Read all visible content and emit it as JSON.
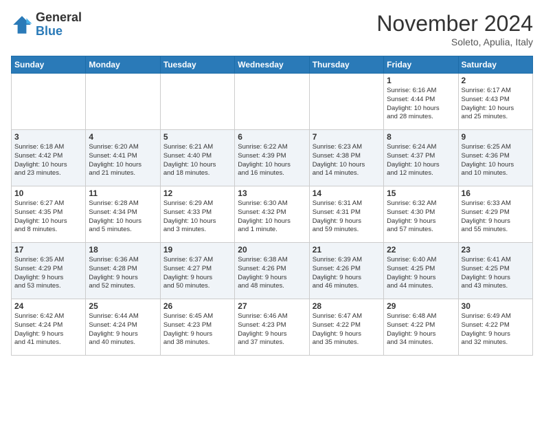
{
  "header": {
    "logo_general": "General",
    "logo_blue": "Blue",
    "month_title": "November 2024",
    "location": "Soleto, Apulia, Italy"
  },
  "days_of_week": [
    "Sunday",
    "Monday",
    "Tuesday",
    "Wednesday",
    "Thursday",
    "Friday",
    "Saturday"
  ],
  "weeks": [
    [
      {
        "day": "",
        "info": ""
      },
      {
        "day": "",
        "info": ""
      },
      {
        "day": "",
        "info": ""
      },
      {
        "day": "",
        "info": ""
      },
      {
        "day": "",
        "info": ""
      },
      {
        "day": "1",
        "info": "Sunrise: 6:16 AM\nSunset: 4:44 PM\nDaylight: 10 hours\nand 28 minutes."
      },
      {
        "day": "2",
        "info": "Sunrise: 6:17 AM\nSunset: 4:43 PM\nDaylight: 10 hours\nand 25 minutes."
      }
    ],
    [
      {
        "day": "3",
        "info": "Sunrise: 6:18 AM\nSunset: 4:42 PM\nDaylight: 10 hours\nand 23 minutes."
      },
      {
        "day": "4",
        "info": "Sunrise: 6:20 AM\nSunset: 4:41 PM\nDaylight: 10 hours\nand 21 minutes."
      },
      {
        "day": "5",
        "info": "Sunrise: 6:21 AM\nSunset: 4:40 PM\nDaylight: 10 hours\nand 18 minutes."
      },
      {
        "day": "6",
        "info": "Sunrise: 6:22 AM\nSunset: 4:39 PM\nDaylight: 10 hours\nand 16 minutes."
      },
      {
        "day": "7",
        "info": "Sunrise: 6:23 AM\nSunset: 4:38 PM\nDaylight: 10 hours\nand 14 minutes."
      },
      {
        "day": "8",
        "info": "Sunrise: 6:24 AM\nSunset: 4:37 PM\nDaylight: 10 hours\nand 12 minutes."
      },
      {
        "day": "9",
        "info": "Sunrise: 6:25 AM\nSunset: 4:36 PM\nDaylight: 10 hours\nand 10 minutes."
      }
    ],
    [
      {
        "day": "10",
        "info": "Sunrise: 6:27 AM\nSunset: 4:35 PM\nDaylight: 10 hours\nand 8 minutes."
      },
      {
        "day": "11",
        "info": "Sunrise: 6:28 AM\nSunset: 4:34 PM\nDaylight: 10 hours\nand 5 minutes."
      },
      {
        "day": "12",
        "info": "Sunrise: 6:29 AM\nSunset: 4:33 PM\nDaylight: 10 hours\nand 3 minutes."
      },
      {
        "day": "13",
        "info": "Sunrise: 6:30 AM\nSunset: 4:32 PM\nDaylight: 10 hours\nand 1 minute."
      },
      {
        "day": "14",
        "info": "Sunrise: 6:31 AM\nSunset: 4:31 PM\nDaylight: 9 hours\nand 59 minutes."
      },
      {
        "day": "15",
        "info": "Sunrise: 6:32 AM\nSunset: 4:30 PM\nDaylight: 9 hours\nand 57 minutes."
      },
      {
        "day": "16",
        "info": "Sunrise: 6:33 AM\nSunset: 4:29 PM\nDaylight: 9 hours\nand 55 minutes."
      }
    ],
    [
      {
        "day": "17",
        "info": "Sunrise: 6:35 AM\nSunset: 4:29 PM\nDaylight: 9 hours\nand 53 minutes."
      },
      {
        "day": "18",
        "info": "Sunrise: 6:36 AM\nSunset: 4:28 PM\nDaylight: 9 hours\nand 52 minutes."
      },
      {
        "day": "19",
        "info": "Sunrise: 6:37 AM\nSunset: 4:27 PM\nDaylight: 9 hours\nand 50 minutes."
      },
      {
        "day": "20",
        "info": "Sunrise: 6:38 AM\nSunset: 4:26 PM\nDaylight: 9 hours\nand 48 minutes."
      },
      {
        "day": "21",
        "info": "Sunrise: 6:39 AM\nSunset: 4:26 PM\nDaylight: 9 hours\nand 46 minutes."
      },
      {
        "day": "22",
        "info": "Sunrise: 6:40 AM\nSunset: 4:25 PM\nDaylight: 9 hours\nand 44 minutes."
      },
      {
        "day": "23",
        "info": "Sunrise: 6:41 AM\nSunset: 4:25 PM\nDaylight: 9 hours\nand 43 minutes."
      }
    ],
    [
      {
        "day": "24",
        "info": "Sunrise: 6:42 AM\nSunset: 4:24 PM\nDaylight: 9 hours\nand 41 minutes."
      },
      {
        "day": "25",
        "info": "Sunrise: 6:44 AM\nSunset: 4:24 PM\nDaylight: 9 hours\nand 40 minutes."
      },
      {
        "day": "26",
        "info": "Sunrise: 6:45 AM\nSunset: 4:23 PM\nDaylight: 9 hours\nand 38 minutes."
      },
      {
        "day": "27",
        "info": "Sunrise: 6:46 AM\nSunset: 4:23 PM\nDaylight: 9 hours\nand 37 minutes."
      },
      {
        "day": "28",
        "info": "Sunrise: 6:47 AM\nSunset: 4:22 PM\nDaylight: 9 hours\nand 35 minutes."
      },
      {
        "day": "29",
        "info": "Sunrise: 6:48 AM\nSunset: 4:22 PM\nDaylight: 9 hours\nand 34 minutes."
      },
      {
        "day": "30",
        "info": "Sunrise: 6:49 AM\nSunset: 4:22 PM\nDaylight: 9 hours\nand 32 minutes."
      }
    ]
  ]
}
